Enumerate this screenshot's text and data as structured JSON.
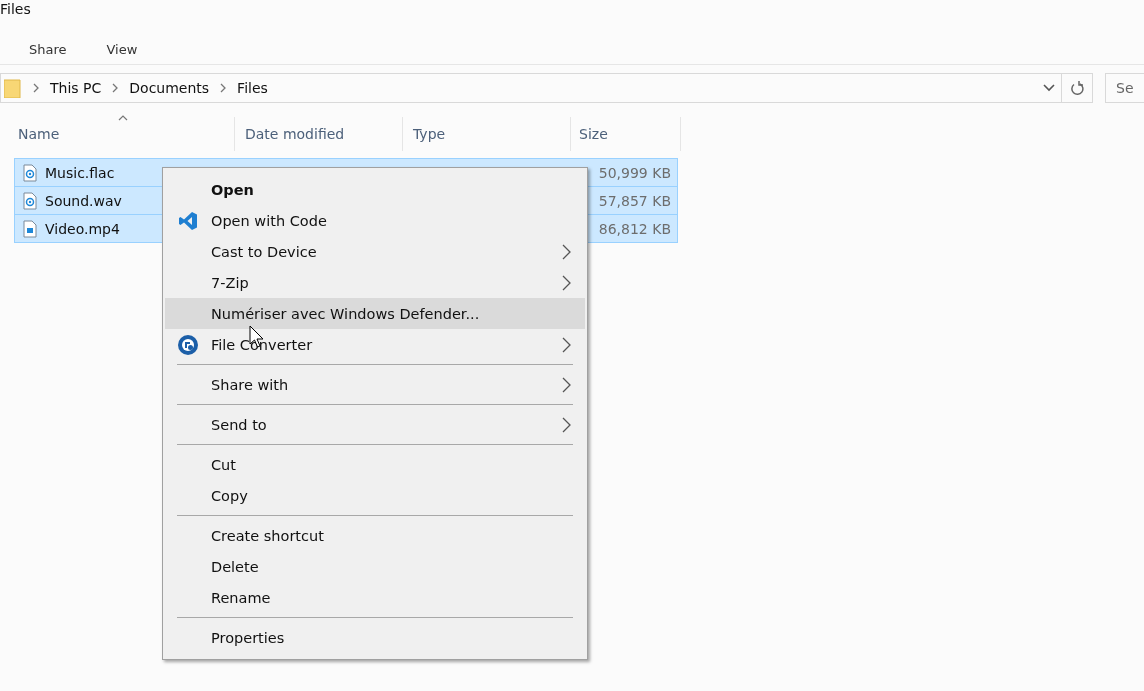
{
  "window": {
    "title": "Files"
  },
  "ribbon": {
    "tabs": [
      {
        "label": "Share",
        "selected": false
      },
      {
        "label": "View",
        "selected": false
      }
    ]
  },
  "address_bar": {
    "path": [
      "This PC",
      "Documents",
      "Files"
    ],
    "search_placeholder": "Se"
  },
  "table": {
    "columns": [
      {
        "label": "Name",
        "sorted": true
      },
      {
        "label": "Date modified",
        "sorted": false
      },
      {
        "label": "Type",
        "sorted": false
      },
      {
        "label": "Size",
        "sorted": false
      }
    ],
    "rows": [
      {
        "name": "Music.flac",
        "kind": "audio",
        "size": "50,999 KB",
        "selected": true
      },
      {
        "name": "Sound.wav",
        "kind": "audio",
        "size": "57,857 KB",
        "selected": true
      },
      {
        "name": "Video.mp4",
        "kind": "video",
        "size": "86,812 KB",
        "selected": true
      }
    ]
  },
  "context_menu": {
    "items": [
      {
        "kind": "item",
        "label": "Open",
        "bold": true,
        "submenu": false,
        "selected": false
      },
      {
        "kind": "code",
        "label": "Open with Code",
        "submenu": false,
        "selected": false
      },
      {
        "kind": "item",
        "label": "Cast to Device",
        "submenu": true,
        "selected": false
      },
      {
        "kind": "item",
        "label": "7-Zip",
        "submenu": true,
        "selected": false
      },
      {
        "kind": "item",
        "label": "Numériser avec Windows Defender...",
        "submenu": false,
        "selected": true
      },
      {
        "kind": "converter",
        "label": "File Converter",
        "submenu": true,
        "selected": false
      },
      {
        "kind": "separator"
      },
      {
        "kind": "item",
        "label": "Share with",
        "submenu": true,
        "selected": false
      },
      {
        "kind": "separator"
      },
      {
        "kind": "item",
        "label": "Send to",
        "submenu": true,
        "selected": false
      },
      {
        "kind": "separator"
      },
      {
        "kind": "item",
        "label": "Cut",
        "submenu": false,
        "selected": false
      },
      {
        "kind": "item",
        "label": "Copy",
        "submenu": false,
        "selected": false
      },
      {
        "kind": "separator"
      },
      {
        "kind": "item",
        "label": "Create shortcut",
        "submenu": false,
        "selected": false
      },
      {
        "kind": "item",
        "label": "Delete",
        "submenu": false,
        "selected": false
      },
      {
        "kind": "item",
        "label": "Rename",
        "submenu": false,
        "selected": false
      },
      {
        "kind": "separator"
      },
      {
        "kind": "item",
        "label": "Properties",
        "submenu": false,
        "selected": false
      }
    ]
  }
}
